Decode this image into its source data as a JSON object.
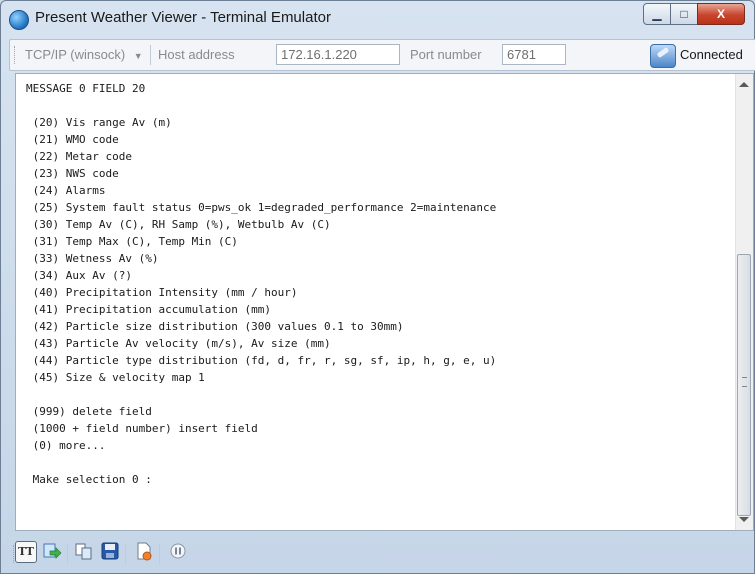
{
  "window": {
    "title": "Present Weather Viewer - Terminal Emulator",
    "minimize_icon": "minimize-icon",
    "maximize_icon": "maximize-icon",
    "close_icon": "close-icon",
    "close_glyph": "X",
    "maximize_glyph": "□",
    "minimize_glyph": "▁"
  },
  "toolbar": {
    "connection_type": "TCP/IP (winsock)",
    "host_label": "Host address",
    "host_value": "172.16.1.220",
    "port_label": "Port number",
    "port_value": "6781",
    "status": "Connected",
    "status_icon": "connected-plug-icon"
  },
  "terminal": {
    "lines": [
      "MESSAGE 0 FIELD 20",
      "",
      " (20) Vis range Av (m)",
      " (21) WMO code",
      " (22) Metar code",
      " (23) NWS code",
      " (24) Alarms",
      " (25) System fault status 0=pws_ok 1=degraded_performance 2=maintenance",
      " (30) Temp Av (C), RH Samp (%), Wetbulb Av (C)",
      " (31) Temp Max (C), Temp Min (C)",
      " (33) Wetness Av (%)",
      " (34) Aux Av (?)",
      " (40) Precipitation Intensity (mm / hour)",
      " (41) Precipitation accumulation (mm)",
      " (42) Particle size distribution (300 values 0.1 to 30mm)",
      " (43) Particle Av velocity (m/s), Av size (mm)",
      " (44) Particle type distribution (fd, d, fr, r, sg, sf, ip, h, g, e, u)",
      " (45) Size & velocity map 1",
      "",
      " (999) delete field",
      " (1000 + field number) insert field",
      " (0) more...",
      "",
      " Make selection 0 :"
    ]
  },
  "bottom_toolbar": {
    "tt_label": "TT",
    "icons": [
      "tt-font-icon",
      "send-file-icon",
      "copy-icon",
      "save-icon",
      "log-file-icon",
      "pause-icon"
    ]
  },
  "colors": {
    "accent": "#1f6fbf",
    "close_button": "#c8452d"
  }
}
